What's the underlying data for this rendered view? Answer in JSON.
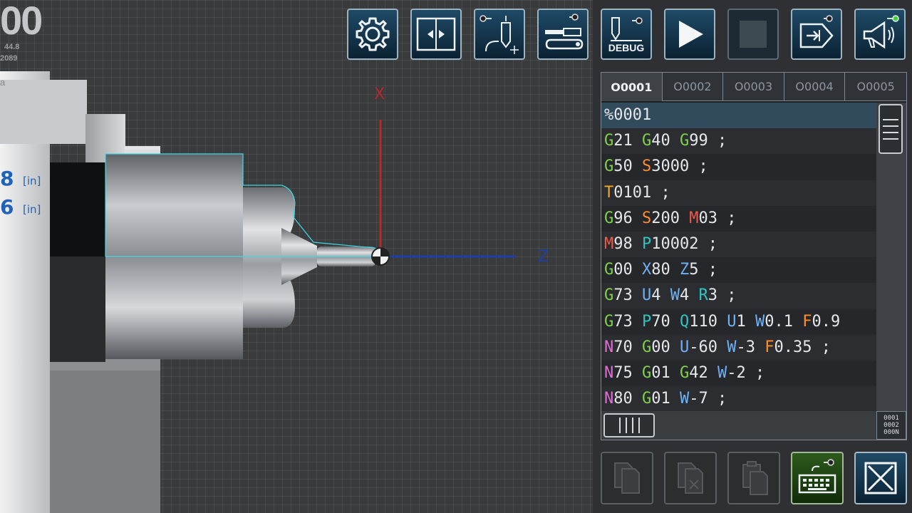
{
  "readouts": {
    "big_digit": "00",
    "small_top": "44.8",
    "small_bottom": "2089",
    "side_char": "a",
    "x_value": "8",
    "x_unit": "[in]",
    "z_value": "6",
    "z_unit": "[in]"
  },
  "axes": {
    "x_label": "X",
    "z_label": "Z",
    "x_color": "#b8272a",
    "z_color": "#1f3fa8"
  },
  "toolbar": {
    "buttons": [
      {
        "name": "settings-button",
        "icon": "gear-icon"
      },
      {
        "name": "machine-doors-button",
        "icon": "doors-icon"
      },
      {
        "name": "tool-geometry-button",
        "icon": "tool-offset-icon"
      },
      {
        "name": "tools-button",
        "icon": "screwdriver-wrench-icon"
      },
      {
        "name": "debug-button",
        "icon": "debug-icon",
        "label": "DEBUG"
      },
      {
        "name": "run-button",
        "icon": "play-icon"
      },
      {
        "name": "stop-button",
        "icon": "stop-icon"
      },
      {
        "name": "export-button",
        "icon": "export-icon"
      },
      {
        "name": "sound-button",
        "icon": "megaphone-icon"
      }
    ]
  },
  "editor": {
    "tabs": [
      "O0001",
      "O0002",
      "O0003",
      "O0004",
      "O0005"
    ],
    "active_tab": 0,
    "lines": [
      "%0001",
      "G21 G40 G99 ;",
      "G50 S3000 ;",
      "T0101 ;",
      "G96 S200 M03 ;",
      "M98 P10002 ;",
      "G00 X80 Z5 ;",
      "G73 U4 W4 R3 ;",
      "G73 P70 Q110 U1 W0.1 F0.9",
      "N70 G00 U-60 W-3 F0.35 ;",
      "N75 G01 G42 W-2 ;",
      "N80 G01 W-7 ;"
    ],
    "selected_line": 0,
    "line_number_toggle": [
      "0001",
      "0002",
      "000N"
    ]
  },
  "actions": [
    {
      "name": "copy-button",
      "icon": "copy-icon",
      "enabled": false
    },
    {
      "name": "cut-button",
      "icon": "cut-icon",
      "enabled": false
    },
    {
      "name": "paste-button",
      "icon": "paste-icon",
      "enabled": false
    },
    {
      "name": "keyboard-button",
      "icon": "keyboard-icon",
      "enabled": true
    },
    {
      "name": "close-button",
      "icon": "close-icon",
      "enabled": true
    }
  ]
}
